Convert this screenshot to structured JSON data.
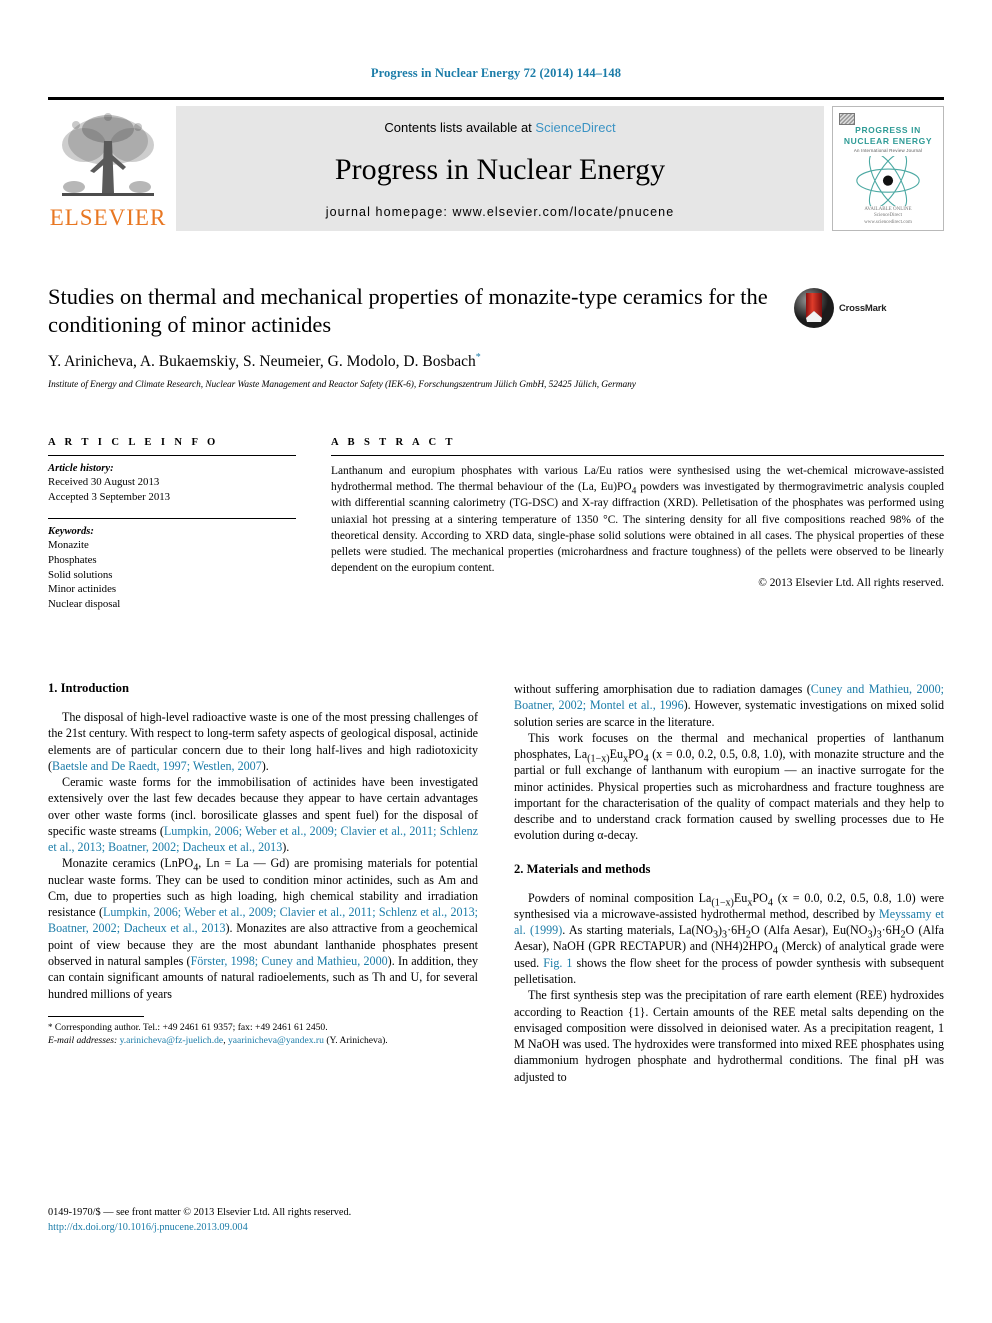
{
  "running_head": "Progress in Nuclear Energy 72 (2014) 144–148",
  "masthead": {
    "publisher_name": "ELSEVIER",
    "contents_prefix": "Contents lists available at ",
    "sciencedirect": "ScienceDirect",
    "journal_title": "Progress in Nuclear Energy",
    "homepage": "journal homepage: www.elsevier.com/locate/pnucene",
    "cover": {
      "line1": "PROGRESS IN",
      "line2": "NUCLEAR ENERGY",
      "line3": "An International Review Journal",
      "foot1": "AVAILABLE ONLINE",
      "foot2": "ScienceDirect",
      "foot3": "www.sciencedirect.com"
    }
  },
  "article": {
    "title": "Studies on thermal and mechanical properties of monazite-type ceramics for the conditioning of minor actinides",
    "authors": "Y. Arinicheva, A. Bukaemskiy, S. Neumeier, G. Modolo, D. Bosbach",
    "author_star": "*",
    "affiliation": "Institute of Energy and Climate Research, Nuclear Waste Management and Reactor Safety (IEK-6), Forschungszentrum Jülich GmbH, 52425 Jülich, Germany",
    "crossmark_label": "CrossMark"
  },
  "info": {
    "heading": "A R T I C L E   I N F O",
    "history_label": "Article history:",
    "received": "Received 30 August 2013",
    "accepted": "Accepted 3 September 2013",
    "keywords_label": "Keywords:",
    "keywords": [
      "Monazite",
      "Phosphates",
      "Solid solutions",
      "Minor actinides",
      "Nuclear disposal"
    ]
  },
  "abstract": {
    "heading": "A B S T R A C T",
    "text": "Lanthanum and europium phosphates with various La/Eu ratios were synthesised using the wet-chemical microwave-assisted hydrothermal method. The thermal behaviour of the (La, Eu)PO4 powders was investigated by thermogravimetric analysis coupled with differential scanning calorimetry (TG-DSC) and X-ray diffraction (XRD). Pelletisation of the phosphates was performed using uniaxial hot pressing at a sintering temperature of 1350 °C. The sintering density for all five compositions reached 98% of the theoretical density. According to XRD data, single-phase solid solutions were obtained in all cases. The physical properties of these pellets were studied. The mechanical properties (microhardness and fracture toughness) of the pellets were observed to be linearly dependent on the europium content.",
    "copyright": "© 2013 Elsevier Ltd. All rights reserved."
  },
  "body": {
    "section1_heading": "1. Introduction",
    "left_p1_a": "The disposal of high-level radioactive waste is one of the most pressing challenges of the 21st century. With respect to long-term safety aspects of geological disposal, actinide elements are of particular concern due to their long half-lives and high radiotoxicity (",
    "left_p1_ref": "Baetsle and De Raedt, 1997; Westlen, 2007",
    "left_p1_b": ").",
    "left_p2_a": "Ceramic waste forms for the immobilisation of actinides have been investigated extensively over the last few decades because they appear to have certain advantages over other waste forms (incl. borosilicate glasses and spent fuel) for the disposal of specific waste streams (",
    "left_p2_ref": "Lumpkin, 2006; Weber et al., 2009; Clavier et al., 2011; Schlenz et al., 2013; Boatner, 2002; Dacheux et al., 2013",
    "left_p2_b": ").",
    "left_p3_a": "Monazite ceramics (LnPO4, Ln = La — Gd) are promising materials for potential nuclear waste forms. They can be used to condition minor actinides, such as Am and Cm, due to properties such as high loading, high chemical stability and irradiation resistance (",
    "left_p3_ref1": "Lumpkin, 2006; Weber et al., 2009; Clavier et al., 2011; Schlenz et al., 2013; Boatner, 2002; Dacheux et al., 2013",
    "left_p3_b": "). Monazites are also attractive from a geochemical point of view because they are the most abundant lanthanide phosphates present observed in natural samples (",
    "left_p3_ref2": "Förster, 1998; Cuney and Mathieu, 2000",
    "left_p3_c": "). In addition, they can contain significant amounts of natural radioelements, such as Th and U, for several hundred millions of years",
    "right_p1_a": "without suffering amorphisation due to radiation damages (",
    "right_p1_ref": "Cuney and Mathieu, 2000; Boatner, 2002; Montel et al., 1996",
    "right_p1_b": "). However, systematic investigations on mixed solid solution series are scarce in the literature.",
    "right_p2_a": "This work focuses on the thermal and mechanical properties of lanthanum phosphates, La(1−x)EuxPO4 (x = 0.0, 0.2, 0.5, 0.8, 1.0), with monazite structure and the partial or full exchange of lanthanum with europium — an inactive surrogate for the minor actinides. Physical properties such as microhardness and fracture toughness are important for the characterisation of the quality of compact materials and they help to describe and to understand crack formation caused by swelling processes due to He evolution during α-decay.",
    "section2_heading": "2. Materials and methods",
    "right_p3_a": "Powders of nominal composition La(1−x)EuxPO4 (x = 0.0, 0.2, 0.5, 0.8, 1.0) were synthesised via a microwave-assisted hydrothermal method, described by ",
    "right_p3_ref": "Meyssamy et al. (1999)",
    "right_p3_b": ". As starting materials, La(NO3)3·6H2O (Alfa Aesar), Eu(NO3)3·6H2O (Alfa Aesar), NaOH (GPR RECTAPUR) and (NH4)2HPO4 (Merck) of analytical grade were used. ",
    "right_p3_figref": "Fig. 1",
    "right_p3_c": " shows the flow sheet for the process of powder synthesis with subsequent pelletisation.",
    "right_p4": "The first synthesis step was the precipitation of rare earth element (REE) hydroxides according to Reaction {1}. Certain amounts of the REE metal salts depending on the envisaged composition were dissolved in deionised water. As a precipitation reagent, 1 M NaOH was used. The hydroxides were transformed into mixed REE phosphates using diammonium hydrogen phosphate and hydrothermal conditions. The final pH was adjusted to"
  },
  "footnote": {
    "star": "*",
    "corresponding": " Corresponding author. Tel.: +49 2461 61 9357; fax: +49 2461 61 2450.",
    "email_label": "E-mail addresses:",
    "email1": "y.arinicheva@fz-juelich.de",
    "email_sep": ", ",
    "email2": "yaarinicheva@yandex.ru",
    "email_tail": " (Y. Arinicheva)."
  },
  "bottom": {
    "issn_line": "0149-1970/$ — see front matter © 2013 Elsevier Ltd. All rights reserved.",
    "doi_line": "http://dx.doi.org/10.1016/j.pnucene.2013.09.004"
  },
  "colors": {
    "link": "#1b7ca8",
    "elsevier_orange": "#E87722",
    "sciencedirect": "#3b93c4",
    "masthead_bg": "#e6e6e6"
  }
}
